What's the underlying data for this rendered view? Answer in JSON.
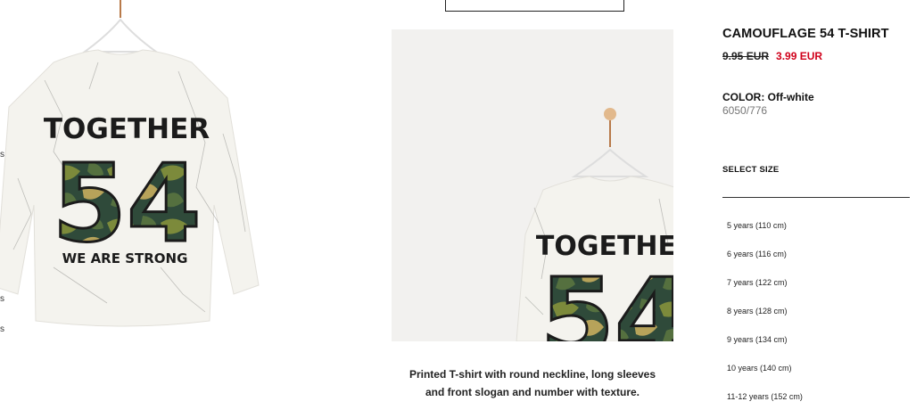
{
  "product": {
    "title": "CAMOUFLAGE 54 T-SHIRT",
    "old_price": "9.95 EUR",
    "new_price": "3.99 EUR",
    "color_label": "COLOR:",
    "color_value": "Off-white",
    "reference": "6050/776",
    "select_size_label": "SELECT SIZE",
    "sizes": [
      "5 years (110 cm)",
      "6 years (116 cm)",
      "7 years (122 cm)",
      "8 years (128 cm)",
      "9 years (134 cm)",
      "10 years (140 cm)",
      "11-12 years (152 cm)"
    ],
    "description_line1": "Printed T-shirt with round neckline, long sleeves",
    "description_line2": "and front slogan and number with texture."
  },
  "graphic": {
    "word_top": "TOGETHER",
    "number": "54",
    "word_bottom": "WE ARE STRONG"
  },
  "left_edge_marks": [
    "s",
    "s",
    "s"
  ],
  "colors": {
    "sale_red": "#d0011b",
    "shirt_white": "#f4f3ee",
    "camo_dark": "#2f4a3a",
    "camo_olive": "#7c8a3b",
    "camo_tan": "#b7a35a"
  }
}
